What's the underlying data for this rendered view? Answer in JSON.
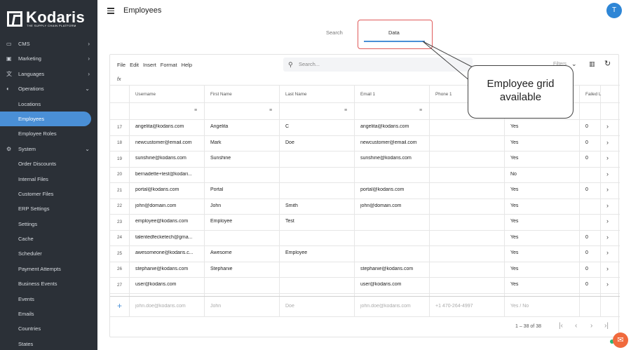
{
  "brand": {
    "name": "Kodaris",
    "tagline": "THE SUPPLY CHAIN PLATFORM"
  },
  "header": {
    "title": "Employees",
    "avatar_letter": "T"
  },
  "sidebar": {
    "items": [
      {
        "label": "CMS",
        "type": "group",
        "icon": "cms-icon",
        "chevron": "›"
      },
      {
        "label": "Marketing",
        "type": "group",
        "icon": "marketing-icon",
        "chevron": "›"
      },
      {
        "label": "Languages",
        "type": "group",
        "icon": "translate-icon",
        "chevron": "›"
      },
      {
        "label": "Operations",
        "type": "group",
        "icon": "operations-icon",
        "chevron": "⌄"
      },
      {
        "label": "Locations",
        "type": "item"
      },
      {
        "label": "Employees",
        "type": "item",
        "active": true
      },
      {
        "label": "Employee Roles",
        "type": "item"
      },
      {
        "label": "System",
        "type": "group",
        "icon": "gear-icon",
        "chevron": "⌄"
      },
      {
        "label": "Order Discounts",
        "type": "item"
      },
      {
        "label": "Internal Files",
        "type": "item"
      },
      {
        "label": "Customer Files",
        "type": "item"
      },
      {
        "label": "ERP Settings",
        "type": "item"
      },
      {
        "label": "Settings",
        "type": "item"
      },
      {
        "label": "Cache",
        "type": "item"
      },
      {
        "label": "Scheduler",
        "type": "item"
      },
      {
        "label": "Payment Attempts",
        "type": "item"
      },
      {
        "label": "Business Events",
        "type": "item"
      },
      {
        "label": "Events",
        "type": "item"
      },
      {
        "label": "Emails",
        "type": "item"
      },
      {
        "label": "Countries",
        "type": "item"
      },
      {
        "label": "States",
        "type": "item"
      }
    ]
  },
  "tabs": {
    "search": "Search",
    "data": "Data"
  },
  "toolbar": {
    "menu": [
      "File",
      "Edit",
      "Insert",
      "Format",
      "Help"
    ],
    "search_placeholder": "Search...",
    "filters_label": "Filters",
    "fx_label": "fx"
  },
  "grid": {
    "columns": [
      "Username",
      "First Name",
      "Last Name",
      "Email 1",
      "Phone 1",
      "",
      "Failed L"
    ],
    "rows": [
      {
        "n": "17",
        "username": "angelita@kodaris.com",
        "first": "Angelita",
        "last": "C",
        "email": "angelita@kodaris.com",
        "phone": "",
        "active": "Yes",
        "failed": "0"
      },
      {
        "n": "18",
        "username": "newcustomer@email.com",
        "first": "Mark",
        "last": "Doe",
        "email": "newcustomer@email.com",
        "phone": "",
        "active": "Yes",
        "failed": "0"
      },
      {
        "n": "19",
        "username": "sunshine@kodaris.com",
        "first": "Sunshine",
        "last": "",
        "email": "sunshine@kodaris.com",
        "phone": "",
        "active": "Yes",
        "failed": "0"
      },
      {
        "n": "20",
        "username": "bernadette+test@kodari...",
        "first": "",
        "last": "",
        "email": "",
        "phone": "",
        "active": "No",
        "failed": ""
      },
      {
        "n": "21",
        "username": "portal@kodaris.com",
        "first": "Portal",
        "last": "",
        "email": "portal@kodaris.com",
        "phone": "",
        "active": "Yes",
        "failed": "0"
      },
      {
        "n": "22",
        "username": "john@domain.com",
        "first": "John",
        "last": "Smith",
        "email": "john@domain.com",
        "phone": "",
        "active": "Yes",
        "failed": ""
      },
      {
        "n": "23",
        "username": "employee@kodaris.com",
        "first": "Employee",
        "last": "Test",
        "email": "",
        "phone": "",
        "active": "Yes",
        "failed": ""
      },
      {
        "n": "24",
        "username": "talentedfecketech@gma...",
        "first": "",
        "last": "",
        "email": "",
        "phone": "",
        "active": "Yes",
        "failed": "0"
      },
      {
        "n": "25",
        "username": "awesomeone@kodaris.c...",
        "first": "Awesome",
        "last": "Employee",
        "email": "",
        "phone": "",
        "active": "Yes",
        "failed": "0"
      },
      {
        "n": "26",
        "username": "stephanie@kodaris.com",
        "first": "Stephanie",
        "last": "",
        "email": "stephanie@kodaris.com",
        "phone": "",
        "active": "Yes",
        "failed": "0"
      },
      {
        "n": "27",
        "username": "user@kodaris.com",
        "first": "",
        "last": "",
        "email": "user@kodaris.com",
        "phone": "",
        "active": "Yes",
        "failed": "0"
      }
    ],
    "new_row": {
      "username": "john.doe@kodaris.com",
      "first": "John",
      "last": "Doe",
      "email": "john.doe@kodaris.com",
      "phone": "+1 470-264-4997",
      "active": "Yes / No"
    }
  },
  "pager": {
    "range": "1 – 38 of 38"
  },
  "callout": {
    "line1": "Employee grid",
    "line2": "available"
  },
  "colors": {
    "sidebar_bg": "#2b3037",
    "accent": "#4a8fd6",
    "highlight": "#e05a5a"
  }
}
